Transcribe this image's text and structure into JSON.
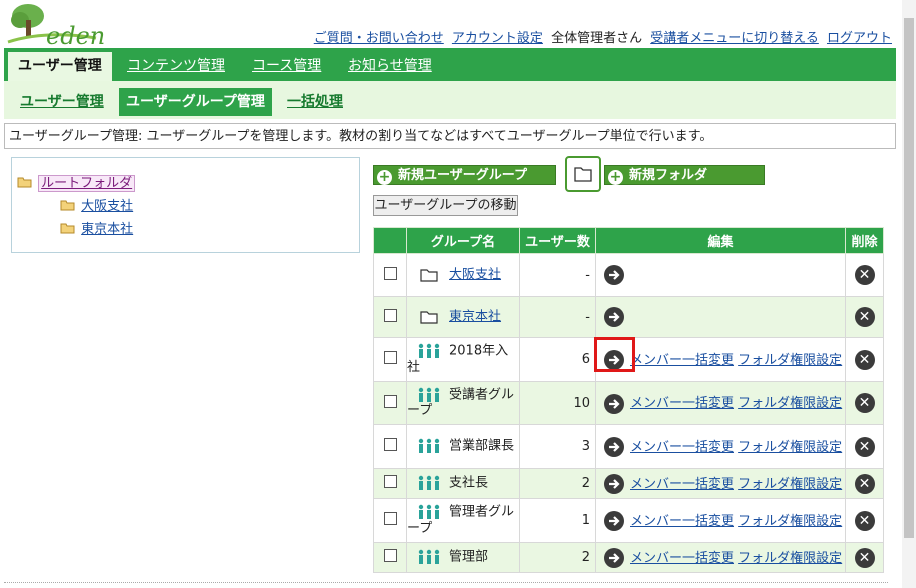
{
  "header": {
    "logo_text": "eden",
    "links": {
      "contact": "ご質問・お問い合わせ",
      "account": "アカウント設定",
      "user": "全体管理者さん",
      "switch": "受講者メニューに切り替える",
      "logout": "ログアウト"
    }
  },
  "nav": {
    "tabs": [
      "ユーザー管理",
      "コンテンツ管理",
      "コース管理",
      "お知らせ管理"
    ],
    "subtabs": [
      "ユーザー管理",
      "ユーザーグループ管理",
      "一括処理"
    ]
  },
  "description": "ユーザーグループ管理: ユーザーグループを管理します。教材の割り当てなどはすべてユーザーグループ単位で行います。",
  "tree": {
    "root": "ルートフォルダ",
    "children": [
      "大阪支社",
      "東京本社"
    ]
  },
  "buttons": {
    "new_group": "新規ユーザーグループ",
    "new_folder": "新規フォルダ",
    "move_group": "ユーザーグループの移動"
  },
  "table": {
    "headers": [
      "グループ名",
      "ユーザー数",
      "編集",
      "削除"
    ],
    "rows": [
      {
        "type": "folder",
        "name": "大阪支社",
        "count": "-"
      },
      {
        "type": "folder",
        "name": "東京本社",
        "count": "-"
      },
      {
        "type": "group",
        "name": "2018年入社",
        "count": "6"
      },
      {
        "type": "group",
        "name": "受講者グループ",
        "count": "10"
      },
      {
        "type": "group",
        "name": "営業部課長",
        "count": "3"
      },
      {
        "type": "group",
        "name": "支社長",
        "count": "2"
      },
      {
        "type": "group",
        "name": "管理者グループ",
        "count": "1"
      },
      {
        "type": "group",
        "name": "管理部",
        "count": "2"
      }
    ],
    "member_link": "メンバー一括変更",
    "perm_link": "フォルダ権限設定"
  },
  "colors": {
    "accent": "#2ea34a",
    "highlight": "#e01818"
  }
}
